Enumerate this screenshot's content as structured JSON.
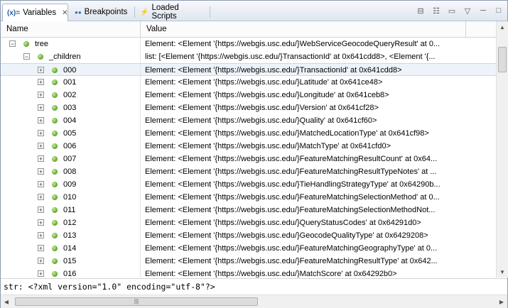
{
  "tabs": [
    {
      "label": "Variables",
      "icon": "variables-icon",
      "glyph": "(x)=",
      "active": true,
      "closable": true
    },
    {
      "label": "Breakpoints",
      "icon": "breakpoints-icon",
      "glyph": "●●",
      "active": false
    },
    {
      "label": "Loaded Scripts",
      "icon": "loaded-scripts-icon",
      "glyph": "⚡",
      "active": false
    }
  ],
  "toolbar": {
    "collapse_icon": "⊟",
    "show_types_icon": "☷",
    "layout_icon": "▭",
    "menu_icon": "▽",
    "minimize_icon": "─",
    "maximize_icon": "□"
  },
  "columns": {
    "name": "Name",
    "value": "Value"
  },
  "rows": [
    {
      "indent": 0,
      "expander": "−",
      "name": "tree",
      "value": "Element: <Element '{https://webgis.usc.edu/}WebServiceGeocodeQueryResult' at 0..."
    },
    {
      "indent": 1,
      "expander": "−",
      "name": "_children",
      "value": "list: [<Element '{https://webgis.usc.edu/}TransactionId' at 0x641cdd8>, <Element '{..."
    },
    {
      "indent": 2,
      "expander": "+",
      "name": "000",
      "value": "Element: <Element '{https://webgis.usc.edu/}TransactionId' at 0x641cdd8>",
      "selected": true
    },
    {
      "indent": 2,
      "expander": "+",
      "name": "001",
      "value": "Element: <Element '{https://webgis.usc.edu/}Latitude' at 0x641ce48>"
    },
    {
      "indent": 2,
      "expander": "+",
      "name": "002",
      "value": "Element: <Element '{https://webgis.usc.edu/}Longitude' at 0x641ceb8>"
    },
    {
      "indent": 2,
      "expander": "+",
      "name": "003",
      "value": "Element: <Element '{https://webgis.usc.edu/}Version' at 0x641cf28>"
    },
    {
      "indent": 2,
      "expander": "+",
      "name": "004",
      "value": "Element: <Element '{https://webgis.usc.edu/}Quality' at 0x641cf60>"
    },
    {
      "indent": 2,
      "expander": "+",
      "name": "005",
      "value": "Element: <Element '{https://webgis.usc.edu/}MatchedLocationType' at 0x641cf98>"
    },
    {
      "indent": 2,
      "expander": "+",
      "name": "006",
      "value": "Element: <Element '{https://webgis.usc.edu/}MatchType' at 0x641cfd0>"
    },
    {
      "indent": 2,
      "expander": "+",
      "name": "007",
      "value": "Element: <Element '{https://webgis.usc.edu/}FeatureMatchingResultCount' at 0x64..."
    },
    {
      "indent": 2,
      "expander": "+",
      "name": "008",
      "value": "Element: <Element '{https://webgis.usc.edu/}FeatureMatchingResultTypeNotes' at ..."
    },
    {
      "indent": 2,
      "expander": "+",
      "name": "009",
      "value": "Element: <Element '{https://webgis.usc.edu/}TieHandlingStrategyType' at 0x64290b..."
    },
    {
      "indent": 2,
      "expander": "+",
      "name": "010",
      "value": "Element: <Element '{https://webgis.usc.edu/}FeatureMatchingSelectionMethod' at 0..."
    },
    {
      "indent": 2,
      "expander": "+",
      "name": "011",
      "value": "Element: <Element '{https://webgis.usc.edu/}FeatureMatchingSelectionMethodNot..."
    },
    {
      "indent": 2,
      "expander": "+",
      "name": "012",
      "value": "Element: <Element '{https://webgis.usc.edu/}QueryStatusCodes' at 0x64291d0>"
    },
    {
      "indent": 2,
      "expander": "+",
      "name": "013",
      "value": "Element: <Element '{https://webgis.usc.edu/}GeocodeQualityType' at 0x6429208>"
    },
    {
      "indent": 2,
      "expander": "+",
      "name": "014",
      "value": "Element: <Element '{https://webgis.usc.edu/}FeatureMatchingGeographyType' at 0..."
    },
    {
      "indent": 2,
      "expander": "+",
      "name": "015",
      "value": "Element: <Element '{https://webgis.usc.edu/}FeatureMatchingResultType' at 0x642..."
    },
    {
      "indent": 2,
      "expander": "+",
      "name": "016",
      "value": "Element: <Element '{https://webgis.usc.edu/}MatchScore' at 0x64292b0>"
    }
  ],
  "detail": "str: <?xml version=\"1.0\" encoding=\"utf-8\"?>",
  "scroll": {
    "up": "▲",
    "down": "▼",
    "left": "◀",
    "right": "▶",
    "grip": "|||"
  },
  "colors": {
    "accent": "#5fa32b",
    "selection": "#eef3fa"
  }
}
